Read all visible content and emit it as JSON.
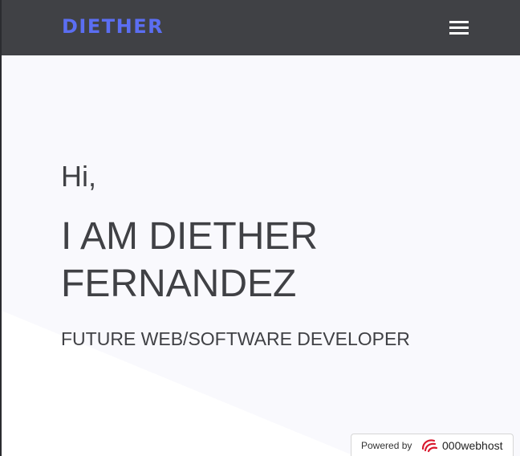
{
  "nav": {
    "brand": "DIETHER",
    "menu_icon": "hamburger-menu-icon"
  },
  "hero": {
    "greeting": "Hi,",
    "headline": "I AM DIETHER FERNANDEZ",
    "subtitle": "FUTURE WEB/SOFTWARE DEVELOPER"
  },
  "badge": {
    "prefix": "Powered by",
    "host": "000webhost",
    "logo_icon": "000webhost-logo-icon"
  },
  "colors": {
    "navbar": "#404145",
    "brand": "#5b6ef2",
    "hero_bg": "#f9f9fd",
    "text": "#404145",
    "logo_red": "#d9182d"
  }
}
